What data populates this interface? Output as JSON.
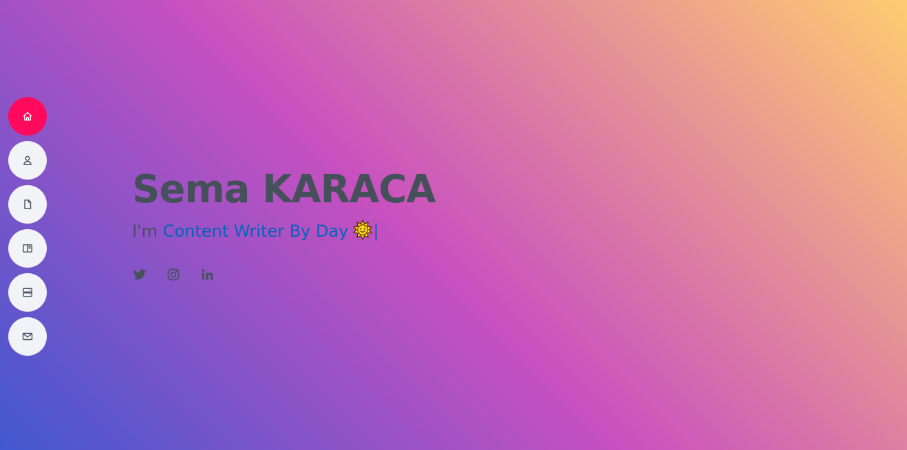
{
  "nav": {
    "items": [
      {
        "icon": "home-icon",
        "active": true
      },
      {
        "icon": "person-icon",
        "active": false
      },
      {
        "icon": "file-icon",
        "active": false
      },
      {
        "icon": "book-icon",
        "active": false
      },
      {
        "icon": "server-icon",
        "active": false
      },
      {
        "icon": "envelope-icon",
        "active": false
      }
    ],
    "active_color": "#ff0a5c",
    "button_color": "#f1f3f6"
  },
  "hero": {
    "name": "Sema KARACA",
    "prefix": "I'm ",
    "typed_text": "Content Writer By Day",
    "cursor": "|",
    "emoji_icon": "sun-icon"
  },
  "social": [
    {
      "icon": "twitter-icon"
    },
    {
      "icon": "instagram-icon"
    },
    {
      "icon": "linkedin-icon"
    }
  ],
  "colors": {
    "text": "#45505b",
    "accent": "#0563bb",
    "gradient": [
      "#4158d0",
      "#c850c0",
      "#ffcc70"
    ]
  }
}
